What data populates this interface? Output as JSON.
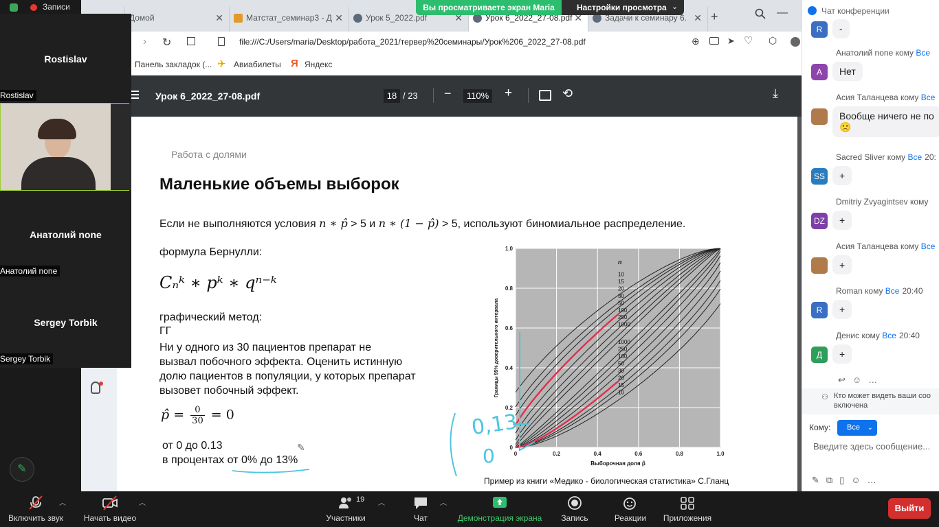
{
  "share_banner": {
    "viewing": "Вы просматриваете экран Maria",
    "view_options": "Настройки просмотра"
  },
  "browser": {
    "tabs": [
      {
        "label": "Записи"
      },
      {
        "label": "Домой"
      },
      {
        "label": "Матстат_семинар3 - Д"
      },
      {
        "label": "Урок 5_2022.pdf"
      },
      {
        "label": "Урок 6_2022_27-08.pdf"
      },
      {
        "label": "Задачи к семинару 6."
      }
    ],
    "url": "file:///C:/Users/maria/Desktop/работа_2021/тервер%20семинары/Урок%206_2022_27-08.pdf",
    "bookmarks": [
      {
        "label": "Панель закладок (..."
      },
      {
        "label": "Авиабилеты"
      },
      {
        "label": "Яндекс"
      }
    ]
  },
  "pdf": {
    "filename": "Урок 6_2022_27-08.pdf",
    "current_page": "18",
    "total_pages": "/ 23",
    "zoom": "110%"
  },
  "slide": {
    "section": "Работа с долями",
    "title": "Маленькие объемы выборок",
    "condition_pre": "Если не выполняются условия ",
    "condition_math1": "n ∗ p̂",
    "condition_mid1": " > 5 и ",
    "condition_math2": "n ∗ (1 − p̂)",
    "condition_post": " > 5, используют биномиальное распределение.",
    "bernoulli_label": "формула Бернулли:",
    "formula": "Cₙᵏ ∗ pᵏ ∗ qⁿ⁻ᵏ",
    "graphic_method": "графический метод:",
    "gg": "ГГ",
    "problem_lines": [
      "Ни у одного из 30 пациентов препарат не",
      "вызвал побочного эффекта.  Оценить истинную",
      "долю пациентов в популяции, у которых препарат",
      "вызовет  побочный эффект."
    ],
    "p_hat_formula_left": "p̂ =",
    "p_hat_num": "0",
    "p_hat_den": "30",
    "p_hat_formula_right": "= 0",
    "range_text": "от 0 до 0.13",
    "percent_text": "в процентах от 0% до 13%",
    "caption": "Пример из книги «Медико - биологическая статистика» С.Гланц",
    "handwritten_note": "0,13",
    "handwritten_zero": "0"
  },
  "chart_data": {
    "type": "line",
    "xlabel": "Выборочная доля p̂",
    "ylabel": "Границы 95% доверительного интервала",
    "xlim": [
      0,
      1.0
    ],
    "ylim": [
      0,
      1.0
    ],
    "xticks": [
      "0",
      "0.2",
      "0.4",
      "0.6",
      "0.8",
      "1.0"
    ],
    "yticks": [
      "0",
      "0.2",
      "0.4",
      "0.6",
      "0.8",
      "1.0"
    ],
    "legend_title": "n",
    "upper_labels": [
      "10",
      "15",
      "20",
      "30",
      "50",
      "100",
      "250",
      "1000"
    ],
    "lower_labels": [
      "1000",
      "250",
      "100",
      "50",
      "30",
      "20",
      "15",
      "10"
    ],
    "grid": true,
    "highlight_color": "#e0304a",
    "curve_color": "#222222"
  },
  "participants": [
    {
      "name": "Rostislav",
      "label": "Rostislav"
    },
    {
      "name": "",
      "label": "Rostislav"
    },
    {
      "name": "Анатолий none",
      "label": "Анатолий none"
    },
    {
      "name": "Sergey Torbik",
      "label": "Sergey Torbik"
    }
  ],
  "chat": {
    "title": "Чат конференции",
    "messages": [
      {
        "avatar": "R",
        "color": "#3a6fc4",
        "sender": "",
        "to": "",
        "time": "",
        "text": "-"
      },
      {
        "avatar": "A",
        "color": "#8e44ad",
        "sender": "Анатолий none кому ",
        "to": "Все",
        "time": "",
        "text": "Нет"
      },
      {
        "avatar": "",
        "color": "#b07a4a",
        "sender": "Асия Таланцева кому ",
        "to": "Все",
        "time": "",
        "text": "Вообще ничего не по"
      },
      {
        "avatar": "SS",
        "color": "#2b7bbf",
        "sender": "Sacred Sliver кому ",
        "to": "Все",
        "time": "20:",
        "text": "+"
      },
      {
        "avatar": "DZ",
        "color": "#7e3fa8",
        "sender": "Dmitriy Zvyagintsev кому ",
        "to": "",
        "time": "",
        "text": "+"
      },
      {
        "avatar": "",
        "color": "#b07a4a",
        "sender": "Асия Таланцева кому ",
        "to": "Все",
        "time": "",
        "text": "+"
      },
      {
        "avatar": "R",
        "color": "#3a6fc4",
        "sender": "Roman кому ",
        "to": "Все",
        "time": "20:40",
        "text": "+"
      },
      {
        "avatar": "Д",
        "color": "#2f9e5a",
        "sender": "Денис кому ",
        "to": "Все",
        "time": "20:40",
        "text": "+"
      }
    ],
    "emoji": "🙁",
    "visibility_note_1": "Кто может видеть ваши соо",
    "visibility_note_2": "включена",
    "to_label": "Кому:",
    "to_value": "Все",
    "input_placeholder": "Введите здесь сообщение..."
  },
  "toolbar": {
    "mute": "Включить звук",
    "video": "Начать видео",
    "participants": "Участники",
    "participants_count": "19",
    "chat": "Чат",
    "share": "Демонстрация экрана",
    "record": "Запись",
    "reactions": "Реакции",
    "apps": "Приложения",
    "leave": "Выйти"
  }
}
